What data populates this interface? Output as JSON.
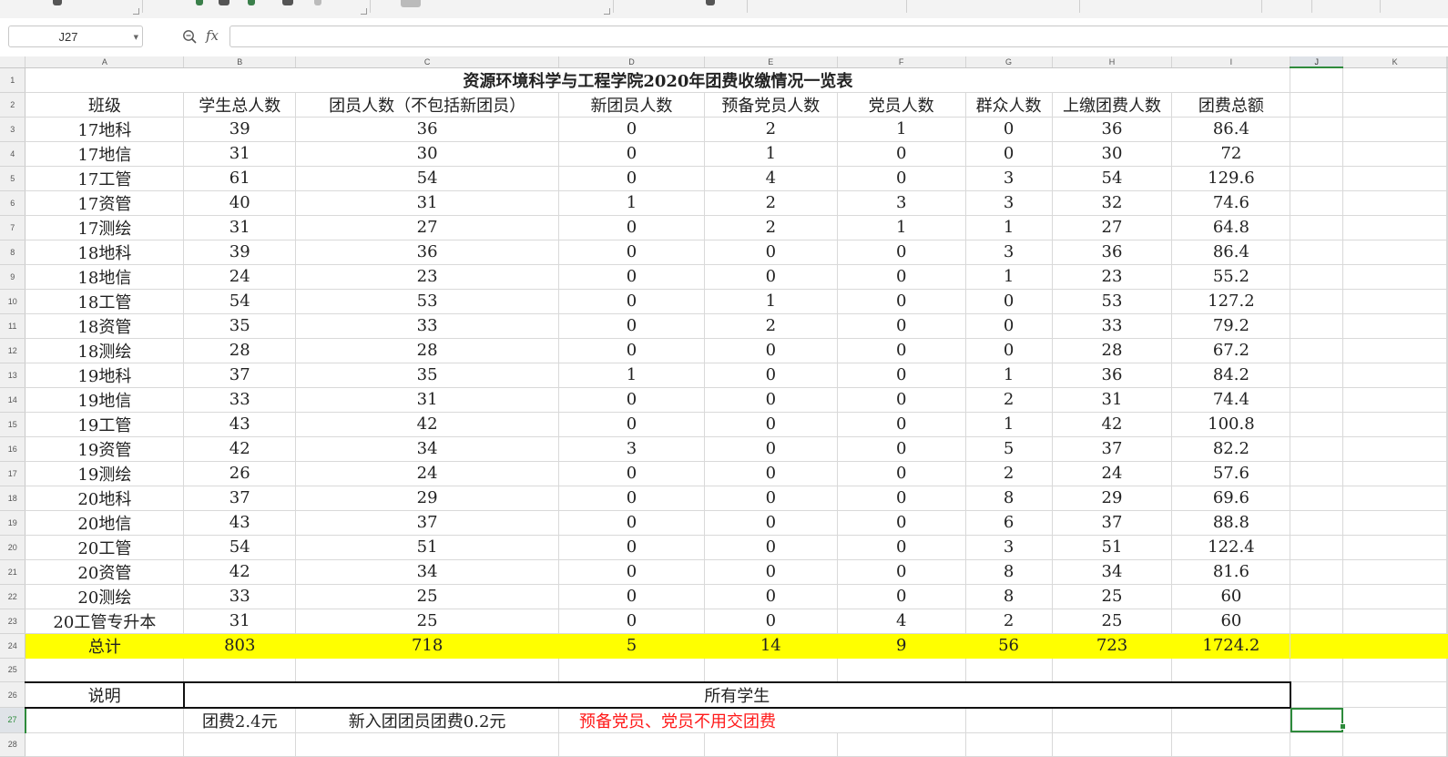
{
  "formula_bar": {
    "cell_ref": "J27",
    "fx_label": "fx",
    "formula": ""
  },
  "columns": [
    "A",
    "B",
    "C",
    "D",
    "E",
    "F",
    "G",
    "H",
    "I",
    "J",
    "K"
  ],
  "rows": [
    "1",
    "2",
    "3",
    "4",
    "5",
    "6",
    "7",
    "8",
    "9",
    "10",
    "11",
    "12",
    "13",
    "14",
    "15",
    "16",
    "17",
    "18",
    "19",
    "20",
    "21",
    "22",
    "23",
    "24",
    "25",
    "26",
    "27",
    "28"
  ],
  "sheet": {
    "title": "资源环境科学与工程学院2020年团费收缴情况一览表",
    "headers": [
      "班级",
      "学生总人数",
      "团员人数（不包括新团员）",
      "新团员人数",
      "预备党员人数",
      "党员人数",
      "群众人数",
      "上缴团费人数",
      "团费总额"
    ],
    "data_rows": [
      [
        "17地科",
        "39",
        "36",
        "0",
        "2",
        "1",
        "0",
        "36",
        "86.4"
      ],
      [
        "17地信",
        "31",
        "30",
        "0",
        "1",
        "0",
        "0",
        "30",
        "72"
      ],
      [
        "17工管",
        "61",
        "54",
        "0",
        "4",
        "0",
        "3",
        "54",
        "129.6"
      ],
      [
        "17资管",
        "40",
        "31",
        "1",
        "2",
        "3",
        "3",
        "32",
        "74.6"
      ],
      [
        "17测绘",
        "31",
        "27",
        "0",
        "2",
        "1",
        "1",
        "27",
        "64.8"
      ],
      [
        "18地科",
        "39",
        "36",
        "0",
        "0",
        "0",
        "3",
        "36",
        "86.4"
      ],
      [
        "18地信",
        "24",
        "23",
        "0",
        "0",
        "0",
        "1",
        "23",
        "55.2"
      ],
      [
        "18工管",
        "54",
        "53",
        "0",
        "1",
        "0",
        "0",
        "53",
        "127.2"
      ],
      [
        "18资管",
        "35",
        "33",
        "0",
        "2",
        "0",
        "0",
        "33",
        "79.2"
      ],
      [
        "18测绘",
        "28",
        "28",
        "0",
        "0",
        "0",
        "0",
        "28",
        "67.2"
      ],
      [
        "19地科",
        "37",
        "35",
        "1",
        "0",
        "0",
        "1",
        "36",
        "84.2"
      ],
      [
        "19地信",
        "33",
        "31",
        "0",
        "0",
        "0",
        "2",
        "31",
        "74.4"
      ],
      [
        "19工管",
        "43",
        "42",
        "0",
        "0",
        "0",
        "1",
        "42",
        "100.8"
      ],
      [
        "19资管",
        "42",
        "34",
        "3",
        "0",
        "0",
        "5",
        "37",
        "82.2"
      ],
      [
        "19测绘",
        "26",
        "24",
        "0",
        "0",
        "0",
        "2",
        "24",
        "57.6"
      ],
      [
        "20地科",
        "37",
        "29",
        "0",
        "0",
        "0",
        "8",
        "29",
        "69.6"
      ],
      [
        "20地信",
        "43",
        "37",
        "0",
        "0",
        "0",
        "6",
        "37",
        "88.8"
      ],
      [
        "20工管",
        "54",
        "51",
        "0",
        "0",
        "0",
        "3",
        "51",
        "122.4"
      ],
      [
        "20资管",
        "42",
        "34",
        "0",
        "0",
        "0",
        "8",
        "34",
        "81.6"
      ],
      [
        "20测绘",
        "33",
        "25",
        "0",
        "0",
        "0",
        "8",
        "25",
        "60"
      ],
      [
        "20工管专升本",
        "31",
        "25",
        "0",
        "0",
        "4",
        "2",
        "25",
        "60"
      ]
    ],
    "total_row": [
      "总计",
      "803",
      "718",
      "5",
      "14",
      "9",
      "56",
      "723",
      "1724.2"
    ],
    "note_label": "说明",
    "note_scope": "所有学生",
    "note_fee": "团费2.4元",
    "note_new_fee": "新入团团员团费0.2元",
    "note_exempt": "预备党员、党员不用交团费"
  },
  "colors": {
    "highlight_row": "#ffff00",
    "selection": "#2e8b3c",
    "note_red": "#ff1a1a"
  },
  "icons": [
    "zoom-icon",
    "dropdown-arrow-icon"
  ]
}
